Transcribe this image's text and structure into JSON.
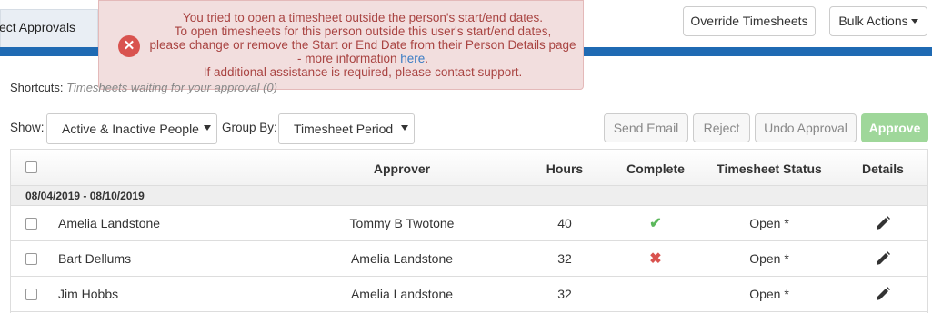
{
  "top": {
    "tab_label": "ect Approvals",
    "override_button": "Override Timesheets",
    "bulk_button": "Bulk Actions"
  },
  "alert": {
    "line1": "You tried to open a timesheet outside the person's start/end dates.",
    "line2": "To open timesheets for this person outside this user's start/end dates,",
    "line3": "please change or remove the Start or End Date from their Person Details page",
    "line4_prefix": "- more information ",
    "line4_link": "here",
    "line4_suffix": ".",
    "line5": "If additional assistance is required, please contact support."
  },
  "shortcuts": {
    "label": "Shortcuts:",
    "link": "Timesheets waiting for your approval (0)"
  },
  "filters": {
    "show_label": "Show:",
    "show_value": "Active & Inactive People",
    "group_label": "Group By:",
    "group_value": "Timesheet Period"
  },
  "actions": {
    "send_email": "Send Email",
    "reject": "Reject",
    "undo_approval": "Undo Approval",
    "approve": "Approve"
  },
  "table": {
    "headers": {
      "approver": "Approver",
      "hours": "Hours",
      "complete": "Complete",
      "status": "Timesheet Status",
      "details": "Details"
    },
    "group_label": "08/04/2019 - 08/10/2019",
    "rows": [
      {
        "name": "Amelia Landstone",
        "approver": "Tommy B Twotone",
        "hours": "40",
        "complete": "✔",
        "status": "Open *"
      },
      {
        "name": "Bart Dellums",
        "approver": "Amelia Landstone",
        "hours": "32",
        "complete": "✖",
        "status": "Open *"
      },
      {
        "name": "Jim Hobbs",
        "approver": "Amelia Landstone",
        "hours": "32",
        "complete": "",
        "status": "Open *"
      }
    ]
  },
  "colors": {
    "accent_bar": "#1f6ab3",
    "alert_bg": "#f2dede",
    "alert_text": "#a94442",
    "approve_bg": "#9fd79a",
    "complete_check": "#5cb85c",
    "complete_cross": "#d9534f"
  },
  "icons": {
    "alert": "close-circle-icon",
    "edit": "pencil-icon",
    "complete_yes": "checkmark-icon",
    "complete_no": "cross-icon"
  }
}
